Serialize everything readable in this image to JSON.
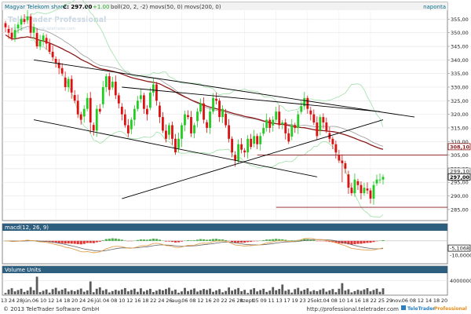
{
  "header": {
    "instrument": "Magyar Telekom share",
    "close_label": "C: 297.00",
    "change": "+1.00",
    "indicators": "boll(20, 2, -2) movs(50, 0) movs(200, 0)",
    "brand_right": "naponta"
  },
  "watermark": {
    "name": "TeleTrader Professional",
    "url": "http://professional.teletrader.com"
  },
  "logo": {
    "tele": "TeleTrader",
    "pro": "Professional"
  },
  "footer": {
    "copyright": "© 2013 TeleTrader Software GmbH",
    "url": "http://professional.teletrader.com"
  },
  "colors": {
    "up": "#22cc22",
    "down": "#dd1111",
    "ma50": "#9a9a9a",
    "ma200": "#8b1a1a",
    "boll": "#9ee0a8",
    "trend": "#000000",
    "macd_line": "#e0a050",
    "signal_line": "#666666",
    "hist_pos": "#4caf50",
    "hist_neg": "#e33333",
    "volume": "#5a5a5a",
    "border": "#888888",
    "panel_title_bg": "#2f5f7f"
  },
  "chart_data": [
    {
      "type": "candlestick",
      "panel": "price",
      "title": "Magyar Telekom share C: 297.00 +1.00",
      "y_ticks": [
        285,
        290,
        295,
        300,
        305,
        310,
        315,
        320,
        325,
        330,
        335,
        340,
        345,
        350,
        355
      ],
      "ylim": [
        281.5,
        358
      ],
      "grid": true,
      "marked_values": [
        {
          "value": 308.1,
          "label": "308,10",
          "color": "#8b1a1a"
        },
        {
          "value": 299.1,
          "label": "299,10",
          "color": "#777777"
        },
        {
          "value": 297.0,
          "label": "297,00",
          "color": "#000000"
        }
      ],
      "horizontal_lines": [
        305.0,
        285.8
      ],
      "closes": [
        352,
        350,
        348,
        351,
        353,
        355,
        354,
        356,
        350,
        352,
        345,
        347,
        349,
        346,
        343,
        341,
        339,
        337,
        335,
        330,
        333,
        328,
        325,
        320,
        318,
        322,
        326,
        317,
        314,
        322,
        321,
        330,
        334,
        329,
        332,
        327,
        324,
        320,
        316,
        313,
        318,
        322,
        325,
        327,
        322,
        320,
        328,
        331,
        325,
        319,
        314,
        311,
        316,
        311,
        306,
        311,
        316,
        320,
        319,
        313,
        316,
        321,
        324,
        318,
        315,
        321,
        326,
        325,
        319,
        322,
        316,
        311,
        306,
        303,
        309,
        307,
        306,
        311,
        308,
        312,
        309,
        312,
        315,
        318,
        315,
        318,
        321,
        316,
        317,
        313,
        310,
        316,
        315,
        320,
        323,
        326,
        322,
        320,
        317,
        312,
        319,
        317,
        314,
        311,
        309,
        306,
        303,
        302,
        300,
        293,
        291,
        296,
        294,
        291,
        293,
        292,
        289,
        294,
        296,
        296,
        297
      ]
    },
    {
      "type": "line",
      "panel": "macd",
      "title": "macd(12, 26, 9)",
      "y_ticks": [
        "-10,0000"
      ],
      "ylim": [
        -15,
        6
      ],
      "marked_values": [
        {
          "value": -5.1068,
          "label": "-5,1068"
        }
      ],
      "grid": true
    },
    {
      "type": "bar",
      "panel": "volume",
      "title": "Volume Units",
      "y_ticks": [
        "4000000"
      ],
      "ylim": [
        0,
        6000000
      ],
      "grid": true
    }
  ],
  "x_axis": {
    "labels": [
      "13",
      "24",
      "28",
      "jún.",
      "06",
      "10",
      "12",
      "14",
      "18",
      "20",
      "24",
      "26",
      "júl.",
      "04",
      "08",
      "10",
      "12",
      "16",
      "18",
      "22",
      "24",
      "26",
      "aug.",
      "06",
      "08",
      "12",
      "16",
      "20",
      "22",
      "26",
      "28",
      "szept.",
      "05",
      "09",
      "11",
      "13",
      "17",
      "19",
      "23",
      "25",
      "okt.",
      "04",
      "08",
      "10",
      "14",
      "16",
      "18",
      "22",
      "25",
      "29",
      "nov.",
      "06",
      "08",
      "12",
      "14",
      "18",
      "20"
    ]
  }
}
